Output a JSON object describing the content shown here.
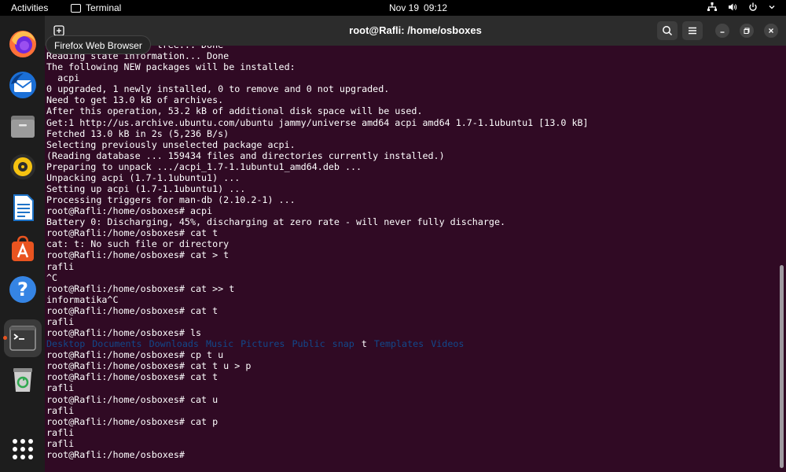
{
  "topbar": {
    "activities": "Activities",
    "app_name": "Terminal",
    "date": "Nov 19",
    "time": "09:12"
  },
  "tooltip": "Firefox Web Browser",
  "headerbar": {
    "title": "root@Rafli: /home/osboxes"
  },
  "dock": {
    "items": [
      {
        "name": "firefox-icon"
      },
      {
        "name": "thunderbird-icon"
      },
      {
        "name": "files-icon"
      },
      {
        "name": "rhythmbox-icon"
      },
      {
        "name": "writer-icon"
      },
      {
        "name": "software-icon"
      },
      {
        "name": "help-icon"
      },
      {
        "name": "terminal-icon"
      },
      {
        "name": "trash-icon"
      }
    ]
  },
  "terminal": {
    "lines": [
      "Building dependency tree... Done",
      "Reading state information... Done",
      "The following NEW packages will be installed:",
      "  acpi",
      "0 upgraded, 1 newly installed, 0 to remove and 0 not upgraded.",
      "Need to get 13.0 kB of archives.",
      "After this operation, 53.2 kB of additional disk space will be used.",
      "Get:1 http://us.archive.ubuntu.com/ubuntu jammy/universe amd64 acpi amd64 1.7-1.1ubuntu1 [13.0 kB]",
      "Fetched 13.0 kB in 2s (5,236 B/s)",
      "Selecting previously unselected package acpi.",
      "(Reading database ... 159434 files and directories currently installed.)",
      "Preparing to unpack .../acpi_1.7-1.1ubuntu1_amd64.deb ...",
      "Unpacking acpi (1.7-1.1ubuntu1) ...",
      "Setting up acpi (1.7-1.1ubuntu1) ...",
      "Processing triggers for man-db (2.10.2-1) ...",
      "root@Rafli:/home/osboxes# acpi",
      "Battery 0: Discharging, 45%, discharging at zero rate - will never fully discharge.",
      "root@Rafli:/home/osboxes# cat t",
      "cat: t: No such file or directory",
      "root@Rafli:/home/osboxes# cat > t",
      "rafli",
      "^C",
      "root@Rafli:/home/osboxes# cat >> t",
      "informatika^C",
      "root@Rafli:/home/osboxes# cat t",
      "rafli",
      "root@Rafli:/home/osboxes# ls"
    ],
    "ls_output": [
      {
        "text": "Desktop",
        "type": "dir"
      },
      {
        "text": "Documents",
        "type": "dir"
      },
      {
        "text": "Downloads",
        "type": "dir"
      },
      {
        "text": "Music",
        "type": "dir"
      },
      {
        "text": "Pictures",
        "type": "dir"
      },
      {
        "text": "Public",
        "type": "dir"
      },
      {
        "text": "snap",
        "type": "dir"
      },
      {
        "text": "t",
        "type": "file"
      },
      {
        "text": "Templates",
        "type": "dir"
      },
      {
        "text": "Videos",
        "type": "dir"
      }
    ],
    "lines_after": [
      "root@Rafli:/home/osboxes# cp t u",
      "root@Rafli:/home/osboxes# cat t u > p",
      "root@Rafli:/home/osboxes# cat t",
      "rafli",
      "root@Rafli:/home/osboxes# cat u",
      "rafli",
      "root@Rafli:/home/osboxes# cat p",
      "rafli",
      "rafli",
      "root@Rafli:/home/osboxes# "
    ]
  },
  "colors": {
    "terminal_bg": "#300a24",
    "dir_color": "#12488b",
    "accent": "#e95420"
  }
}
